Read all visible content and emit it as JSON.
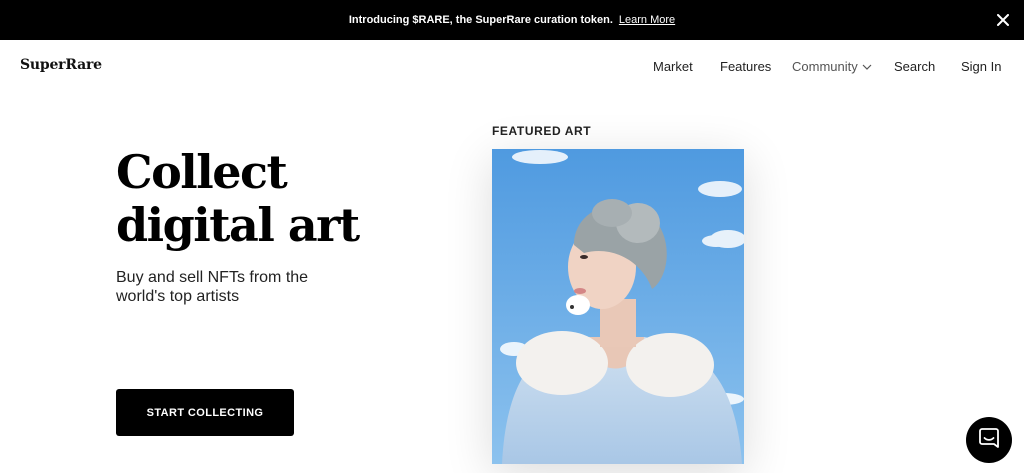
{
  "banner": {
    "message": "Introducing $RARE, the SuperRare curation token.",
    "link": "Learn More",
    "close_icon": "close-icon"
  },
  "nav": {
    "logo": "SuperRare",
    "items": [
      "Market",
      "Features",
      "Community",
      "Search",
      "Sign In"
    ],
    "community_icon": "chevron-down-icon"
  },
  "hero": {
    "title": "Collect digital art",
    "subtitle": "Buy and sell NFTs from the world's top artists",
    "cta": "START COLLECTING"
  },
  "featured": {
    "label": "FEATURED ART"
  },
  "chat": {
    "icon": "chat-icon"
  },
  "colors": {
    "banner_bg": "#000000",
    "cta_bg": "#000000",
    "sky": "#5aa3e3"
  }
}
